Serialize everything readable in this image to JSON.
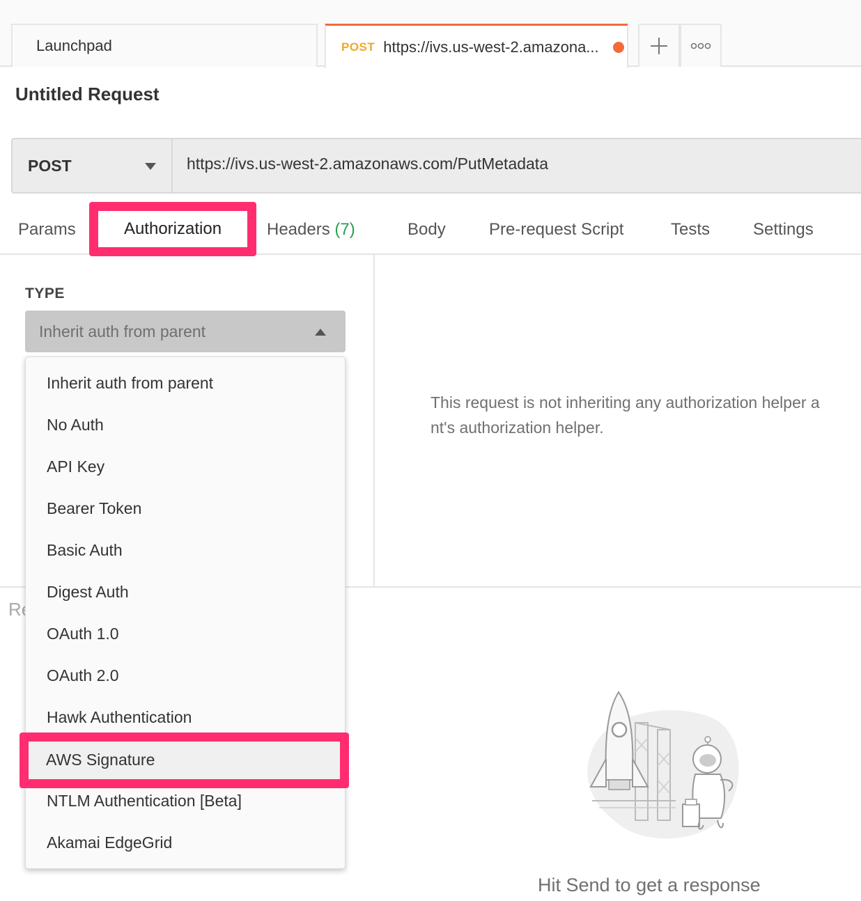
{
  "tabs": {
    "launchpad": "Launchpad",
    "active_method": "POST",
    "active_url": "https://ivs.us-west-2.amazona...",
    "plus_icon": "plus-icon",
    "more_icon": "more-icon",
    "unsaved_color": "#f26b3a"
  },
  "request": {
    "title": "Untitled Request",
    "method": "POST",
    "url": "https://ivs.us-west-2.amazonaws.com/PutMetadata"
  },
  "subtabs": {
    "params": "Params",
    "authorization": "Authorization",
    "headers": "Headers",
    "headers_count": "(7)",
    "body": "Body",
    "prerequest": "Pre-request Script",
    "tests": "Tests",
    "settings": "Settings"
  },
  "auth": {
    "type_label": "TYPE",
    "selected": "Inherit auth from parent",
    "info_line1": "This request is not inheriting any authorization helper a",
    "info_line2": "nt's authorization helper."
  },
  "dropdown": {
    "items": [
      "Inherit auth from parent",
      "No Auth",
      "API Key",
      "Bearer Token",
      "Basic Auth",
      "Digest Auth",
      "OAuth 1.0",
      "OAuth 2.0",
      "Hawk Authentication",
      "AWS Signature",
      "NTLM Authentication [Beta]",
      "Akamai EdgeGrid"
    ],
    "highlight_color": "#ff2d6f"
  },
  "response": {
    "label": "Re",
    "empty_message": "Hit Send to get a response",
    "illustration": "rocket-astronaut-illustration"
  }
}
